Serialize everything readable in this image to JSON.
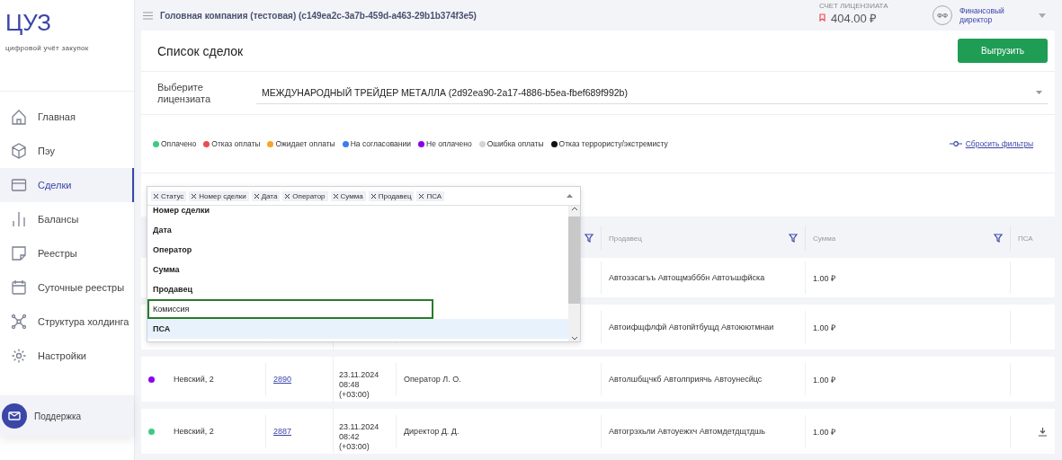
{
  "sidebar": {
    "logo": "ЦУЗ",
    "tagline": "цифровой учёт закупок",
    "items": [
      {
        "label": "Главная",
        "selected": false
      },
      {
        "label": "Пэу",
        "selected": false
      },
      {
        "label": "Сделки",
        "selected": true
      },
      {
        "label": "Балансы",
        "selected": false
      },
      {
        "label": "Реестры",
        "selected": false
      },
      {
        "label": "Суточные реестры",
        "selected": false
      },
      {
        "label": "Структура холдинга",
        "selected": false
      },
      {
        "label": "Настройки",
        "selected": false
      }
    ],
    "support": "Поддержка"
  },
  "topbar": {
    "company": "Головная компания (тестовая) (c149ea2c-3a7b-459d-a463-29b1b374f3e5)",
    "account_label": "СЧЕТ ЛИЦЕНЗИАТА",
    "balance": "404.00 ₽",
    "avatar": "ФФ",
    "role": "Финансовый директор"
  },
  "page": {
    "title": "Список сделок",
    "export_button": "Выгрузить",
    "licensee_label": "Выберите лицензиата",
    "licensee_value": "МЕЖДУНАРОДНЫЙ ТРЕЙДЕР МЕТАЛЛА (2d92ea90-2a17-4886-b5ea-fbef689f992b)"
  },
  "legend": [
    {
      "label": "Оплачено",
      "color": "#3ccb7f"
    },
    {
      "label": "Отказ оплаты",
      "color": "#f04b4b"
    },
    {
      "label": "Ожидает оплаты",
      "color": "#f5a623"
    },
    {
      "label": "На согласовании",
      "color": "#3b7cf0"
    },
    {
      "label": "Не оплачено",
      "color": "#8a00f0"
    },
    {
      "label": "Ошибка оплаты",
      "color": "#d0d3d9"
    },
    {
      "label": "Отказ террористу/экстремисту",
      "color": "#111111"
    }
  ],
  "reset_filters": "Сбросить фильтры",
  "column_picker": {
    "tags": [
      "Статус",
      "Номер сделки",
      "Дата",
      "Оператор",
      "Сумма",
      "Продавец",
      "ПСА"
    ],
    "options": [
      {
        "label": "Номер сделки",
        "selected": true,
        "highlighted": false,
        "focused": false
      },
      {
        "label": "Дата",
        "selected": true,
        "highlighted": false,
        "focused": false
      },
      {
        "label": "Оператор",
        "selected": true,
        "highlighted": false,
        "focused": false
      },
      {
        "label": "Сумма",
        "selected": true,
        "highlighted": false,
        "focused": false
      },
      {
        "label": "Продавец",
        "selected": true,
        "highlighted": false,
        "focused": false
      },
      {
        "label": "Комиссия",
        "selected": false,
        "highlighted": false,
        "focused": true
      },
      {
        "label": "ПСА",
        "selected": true,
        "highlighted": true,
        "focused": false
      }
    ]
  },
  "table": {
    "columns": [
      {
        "filter": true
      },
      {
        "label": "Продавец",
        "filter": true
      },
      {
        "label": "Сумма",
        "filter": true
      },
      {
        "label": "ПСА",
        "filter": false
      }
    ],
    "rows": [
      {
        "seller": "Автоэзсагъъ Автощмзбббн Автоъшфйска",
        "sum": "1.00 ₽",
        "download": false
      },
      {
        "seller": "Автоифщфлфй Автопйтбущд Автоюютмнаи",
        "sum": "1.00 ₽",
        "download": false
      },
      {
        "color": "#8a00f0",
        "address": "Невский, 2",
        "number": "2890",
        "date": [
          "23.11.2024",
          "08:48",
          "(+03:00)"
        ],
        "operator": "Оператор Л. О.",
        "seller": "Автолшбщчкб Автолприячь Автоунесйцс",
        "sum": "1.00 ₽",
        "download": false
      },
      {
        "color": "#3ccb7f",
        "address": "Невский, 2",
        "number": "2887",
        "date": [
          "23.11.2024",
          "08:42",
          "(+03:00)"
        ],
        "operator": "Директор Д. Д.",
        "seller": "Автогрэхьли Автоуежхч Автомдетдщтдшь",
        "sum": "1.00 ₽",
        "download": true
      }
    ]
  }
}
